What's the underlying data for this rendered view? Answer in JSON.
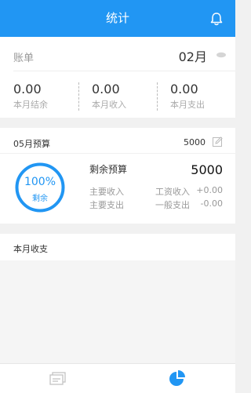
{
  "header": {
    "title": "统计"
  },
  "bill": {
    "label": "账单",
    "month": "02月",
    "stats": [
      {
        "value": "0.00",
        "caption": "本月结余"
      },
      {
        "value": "0.00",
        "caption": "本月收入"
      },
      {
        "value": "0.00",
        "caption": "本月支出"
      }
    ]
  },
  "budget": {
    "title": "05月预算",
    "amount": "5000",
    "ring_percent": "100%",
    "ring_label": "剩余",
    "remaining_label": "剩余预算",
    "remaining_value": "5000",
    "rows": [
      {
        "label": "主要收入",
        "category": "工资收入",
        "amount": "+0.00"
      },
      {
        "label": "主要支出",
        "category": "一般支出",
        "amount": "-0.00"
      }
    ]
  },
  "monthly": {
    "title": "本月收支"
  },
  "colors": {
    "accent": "#2196f3"
  },
  "icons": {
    "header_right": "bell-icon",
    "bill_toggle": "eye-icon",
    "budget_edit": "edit-icon",
    "tab_left": "cards-icon",
    "tab_right": "pie-chart-icon"
  }
}
